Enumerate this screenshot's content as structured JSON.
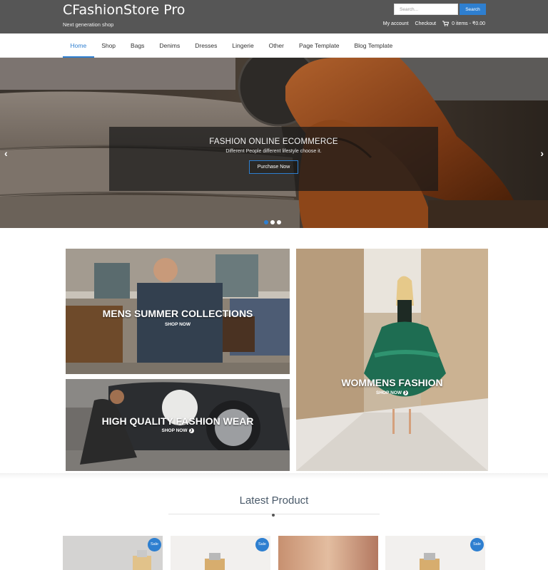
{
  "header": {
    "brand": "CFashionStore Pro",
    "tagline": "Next generation shop",
    "search": {
      "placeholder": "Search...",
      "button_label": "Search"
    },
    "links": {
      "my_account": "My account",
      "checkout": "Checkout",
      "cart": "0 items - ₹0.00"
    }
  },
  "nav": {
    "items": [
      {
        "label": "Home",
        "active": true
      },
      {
        "label": "Shop"
      },
      {
        "label": "Bags"
      },
      {
        "label": "Denims"
      },
      {
        "label": "Dresses"
      },
      {
        "label": "Lingerie"
      },
      {
        "label": "Other"
      },
      {
        "label": "Page Template"
      },
      {
        "label": "Blog Template"
      }
    ]
  },
  "slider": {
    "title": "FASHION ONLINE ECOMMERCE",
    "subtitle": "Different People different lifestyle choose it.",
    "button": "Purchase Now",
    "dots": 3,
    "active_dot": 1
  },
  "promos": [
    {
      "title": "MENS SUMMER COLLECTIONS",
      "link": "SHOP NOW"
    },
    {
      "title": "HIGH QUALITY FASHION WEAR",
      "link": "SHOP NOW"
    },
    {
      "title": "WOMMENS FASHION",
      "link": "SHOP NOW"
    }
  ],
  "latest": {
    "title": "Latest Product",
    "badge": "Sale"
  },
  "colors": {
    "accent": "#2e7fd0",
    "topbar": "#565656"
  }
}
